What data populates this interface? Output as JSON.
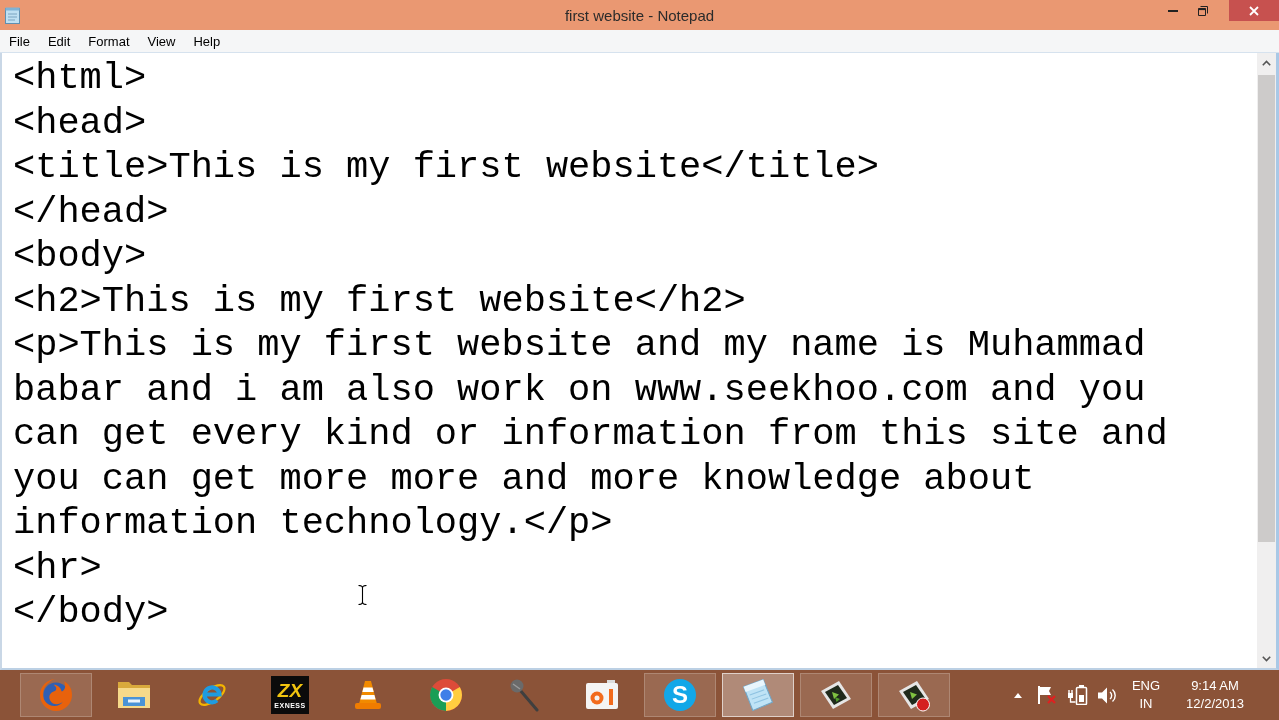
{
  "window": {
    "title": "first website - Notepad"
  },
  "menu": [
    "File",
    "Edit",
    "Format",
    "View",
    "Help"
  ],
  "editor": {
    "lines": [
      "<html>",
      "<head>",
      "<title>This is my first website</title>",
      "</head>",
      "<body>",
      "<h2>This is my first website</h2>",
      "<p>This is my first website and my name is Muhammad",
      "babar and i am also work on www.seekhoo.com and you",
      "can get every kind or information from this site and",
      "you can get more more and more knowledge about",
      "information technology.</p>",
      "<hr>",
      "</body>"
    ]
  },
  "taskbar": {
    "apps": [
      {
        "kind": "foxglobe",
        "running": true,
        "selected": false
      },
      {
        "kind": "folder",
        "running": false,
        "selected": false
      },
      {
        "kind": "eorbit",
        "running": false,
        "selected": false
      },
      {
        "kind": "logotile",
        "running": false,
        "selected": false,
        "logo_mark": "ZX",
        "logo_text": "EXNESS"
      },
      {
        "kind": "cone",
        "running": false,
        "selected": false
      },
      {
        "kind": "ringlogo",
        "running": false,
        "selected": false
      },
      {
        "kind": "microphone",
        "running": false,
        "selected": false
      },
      {
        "kind": "recordtile",
        "running": false,
        "selected": false
      },
      {
        "kind": "lettercircle",
        "running": true,
        "selected": false,
        "logo_text": "S"
      },
      {
        "kind": "notepad",
        "running": true,
        "selected": true
      },
      {
        "kind": "screentile",
        "running": true,
        "selected": false
      },
      {
        "kind": "screenrec",
        "running": true,
        "selected": false
      }
    ],
    "tray": {
      "language": "ENG",
      "region": "IN",
      "time": "9:14 AM",
      "date": "12/2/2013"
    }
  }
}
